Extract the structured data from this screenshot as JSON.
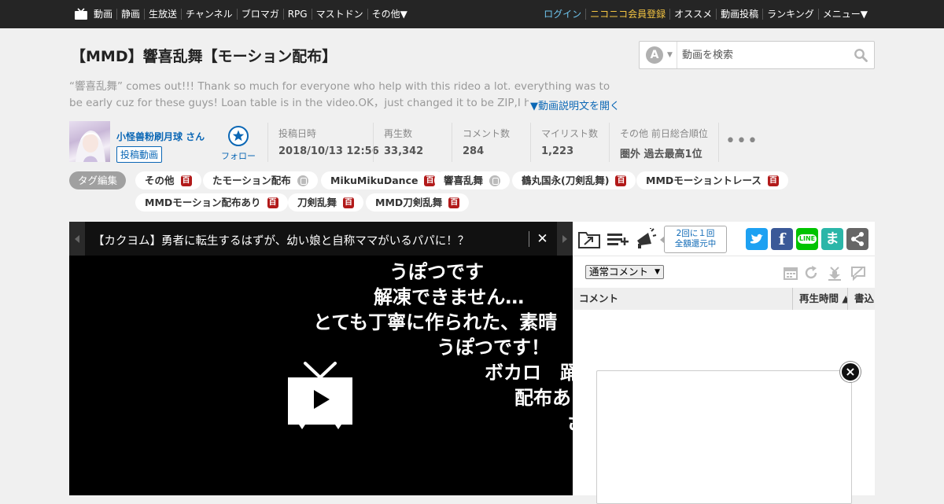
{
  "topbar": {
    "left_items": [
      "動画",
      "静画",
      "生放送",
      "チャンネル",
      "ブロマガ",
      "RPG",
      "マストドン",
      "その他▼"
    ],
    "right_items": [
      "ログイン",
      "ニコニコ会員登録",
      "オススメ",
      "動画投稿",
      "ランキング",
      "メニュー▼"
    ],
    "colors": {
      "login": "#6fc5ef",
      "member": "#f5c542",
      "bar": "#252525"
    }
  },
  "video": {
    "title": "【MMD】響喜乱舞【モーション配布】",
    "description": "“響喜乱舞” comes out!!! Thank so much for everyone who help with this rideo a lot. everything was to be early cuz for these guys! Loan table is in the video.OK，just changed it to be ZIP,I hope everyone to",
    "description_toggle": "▼動画説明文を開く"
  },
  "search": {
    "placeholder": "動画を検索",
    "mode_icon": "A"
  },
  "uploader": {
    "name": "小怪兽粉刷月球 さん",
    "videos_label": "投稿動画",
    "follow_label": "フォロー"
  },
  "stats": {
    "posted_label": "投稿日時",
    "posted_value": "2018/10/13 12:56",
    "views_label": "再生数",
    "views_value": "33,342",
    "comments_label": "コメント数",
    "comments_value": "284",
    "mylist_label": "マイリスト数",
    "mylist_value": "1,223",
    "rank_label": "その他  前日総合順位",
    "rank_value": "圏外  過去最高1位"
  },
  "tags": {
    "edit_label": "タグ編集",
    "items": [
      {
        "label": "その他",
        "badge": "百"
      },
      {
        "label": "たモーション配布",
        "badge": "lock"
      },
      {
        "label": "MikuMikuDance",
        "badge": "百"
      },
      {
        "label": "響喜乱舞",
        "badge": "lock"
      },
      {
        "label": "鶴丸国永(刀剣乱舞)",
        "badge": "百"
      },
      {
        "label": "MMDモーショントレース",
        "badge": "百"
      },
      {
        "label": "MMDモーション配布あり",
        "badge": "百"
      },
      {
        "label": "刀剣乱舞",
        "badge": "百"
      },
      {
        "label": "MMD刀剣乱舞",
        "badge": "百"
      }
    ]
  },
  "player": {
    "ad_text": "【カクヨム】勇者に転生するはずが、幼い娘と自称ママがいるパパに！？",
    "ad_close": "✕",
    "comments": [
      "うぽつです",
      "解凍できません…",
      "とても丁寧に作られた、素晴",
      "うぽつです！",
      "ボカロ　踊",
      "配布あ",
      "さ"
    ]
  },
  "sidepanel": {
    "promo_line1": "2回に１回",
    "promo_line2": "全額還元中",
    "share_twitter": "",
    "share_facebook": "f",
    "share_line": "LINE",
    "share_hatena": "ま",
    "comment_filter": "通常コメント",
    "col_comment": "コメント",
    "col_time": "再生時間 ▲",
    "col_written": "書込日",
    "share_colors": {
      "twitter": "#1da1f2",
      "facebook": "#3b5998",
      "line": "#00c300",
      "hatena": "#2bb6a8",
      "share": "#666666"
    }
  }
}
